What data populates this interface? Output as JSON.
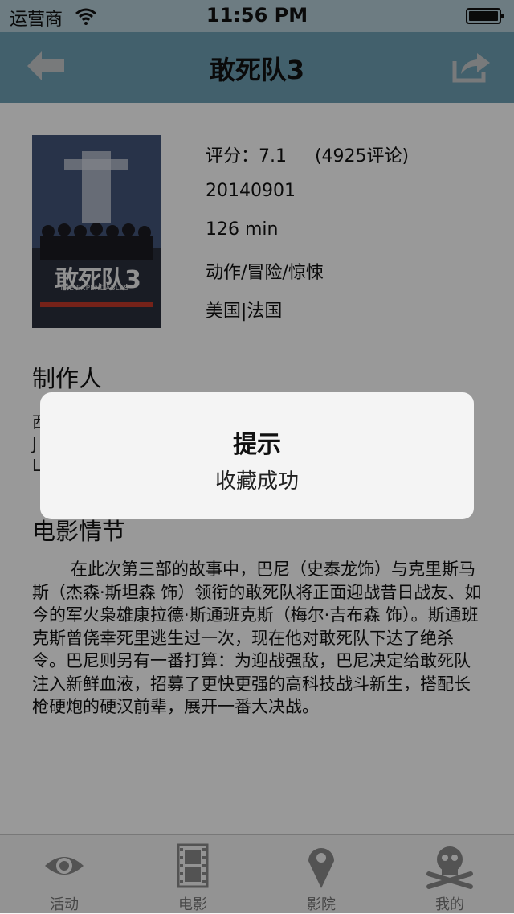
{
  "status_bar": {
    "carrier": "运营商",
    "time": "11:56 PM"
  },
  "nav": {
    "title": "敢死队3",
    "back_icon": "back-arrow-icon",
    "share_icon": "share-icon"
  },
  "movie": {
    "poster_title": "敢死队3",
    "poster_subtitle": "THE EXPENDABLES",
    "rating_line": "评分：7.1     (4925评论)",
    "release_date": "20140901",
    "runtime": "126 min",
    "genre": "动作/冒险/惊悚",
    "country": "美国|法国"
  },
  "sections": {
    "producer_title": "制作人",
    "producer_lines": [
      "西",
      "J                                                      t",
      "L"
    ],
    "plot_title": "电影情节",
    "plot_text": "在此次第三部的故事中，巴尼（史泰龙饰）与克里斯马斯（杰森·斯坦森 饰）领衔的敢死队将正面迎战昔日战友、如今的军火枭雄康拉德·斯通班克斯（梅尔·吉布森 饰）。斯通班克斯曾侥幸死里逃生过一次，现在他对敢死队下达了绝杀令。巴尼则另有一番打算：为迎战强敌，巴尼决定给敢死队注入新鲜血液，招募了更快更强的高科技战斗新生，搭配长枪硬炮的硬汉前辈，展开一番大决战。"
  },
  "alert": {
    "title": "提示",
    "message": "收藏成功"
  },
  "tabs": [
    {
      "label": "活动",
      "icon": "eye-icon"
    },
    {
      "label": "电影",
      "icon": "film-icon"
    },
    {
      "label": "影院",
      "icon": "location-pin-icon"
    },
    {
      "label": "我的",
      "icon": "skull-crossbones-icon"
    }
  ],
  "colors": {
    "nav_bar": "#6ea0b4",
    "status_bar": "#b6cfd9",
    "tab_icon": "#8a8a8a"
  }
}
